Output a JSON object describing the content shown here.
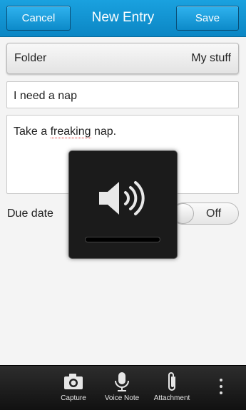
{
  "header": {
    "cancel_label": "Cancel",
    "title": "New Entry",
    "save_label": "Save"
  },
  "form": {
    "folder": {
      "label": "Folder",
      "value": "My stuff"
    },
    "title_value": "I need a nap",
    "notes_value": {
      "before": "Take a ",
      "misspelled": "freaking",
      "after": " nap."
    },
    "due_date": {
      "label": "Due date",
      "toggle_state": "Off"
    }
  },
  "volume_overlay": {
    "icon": "speaker-volume-icon",
    "level": 0.0
  },
  "action_bar": {
    "items": [
      {
        "label": "Capture",
        "icon": "camera-icon"
      },
      {
        "label": "Voice Note",
        "icon": "microphone-icon"
      },
      {
        "label": "Attachment",
        "icon": "paperclip-icon"
      }
    ],
    "overflow_icon": "overflow-menu-icon"
  },
  "colors": {
    "accent": "#0b86c4",
    "background": "#f4f4f4",
    "overlay": "#1b1b1b"
  }
}
